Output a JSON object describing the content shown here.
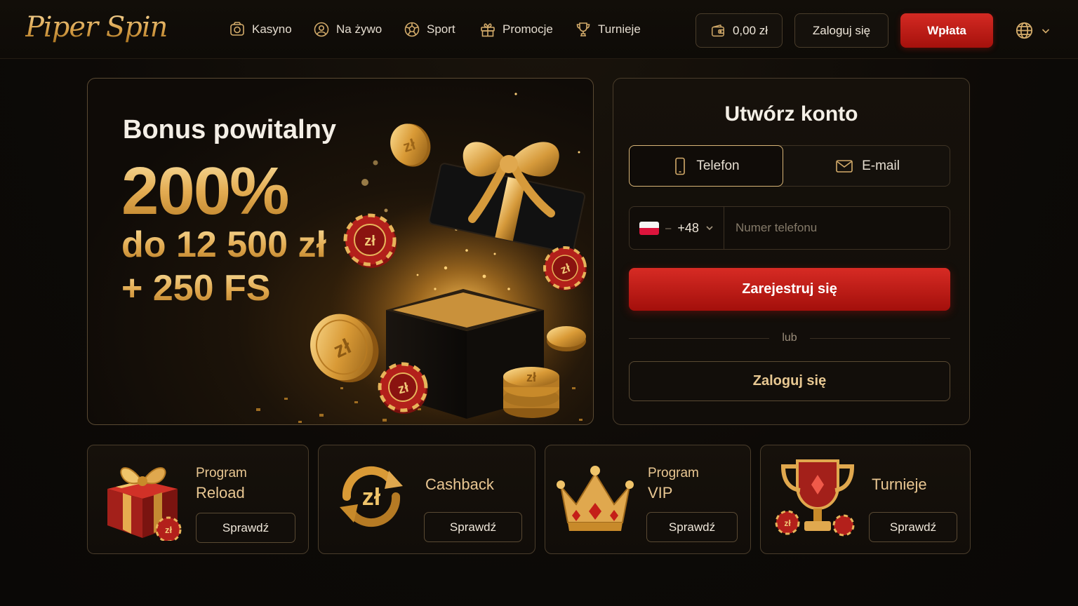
{
  "header": {
    "logo": "Piper Spin",
    "nav": [
      {
        "label": "Kasyno",
        "icon": "casino-icon"
      },
      {
        "label": "Na żywo",
        "icon": "live-icon"
      },
      {
        "label": "Sport",
        "icon": "soccer-ball-icon"
      },
      {
        "label": "Promocje",
        "icon": "gift-icon"
      },
      {
        "label": "Turnieje",
        "icon": "trophy-icon"
      }
    ],
    "balance": "0,00 zł",
    "login": "Zaloguj się",
    "deposit": "Wpłata",
    "language_icon": "globe-icon"
  },
  "hero": {
    "title": "Bonus powitalny",
    "percent": "200%",
    "amount": "do 12 500 zł",
    "free_spins": "+ 250 FS",
    "chip_symbol": "zł"
  },
  "register": {
    "title": "Utwórz konto",
    "tabs": [
      {
        "label": "Telefon",
        "icon": "smartphone-icon",
        "active": true
      },
      {
        "label": "E-mail",
        "icon": "mail-icon",
        "active": false
      }
    ],
    "country_separator": "–",
    "country_code": "+48",
    "phone_placeholder": "Numer telefonu",
    "submit": "Zarejestruj się",
    "or": "lub",
    "login": "Zaloguj się"
  },
  "promos": [
    {
      "line1": "Program",
      "line2": "Reload",
      "button": "Sprawdź",
      "icon": "gift-box-icon"
    },
    {
      "line1": "Cashback",
      "line2": "",
      "button": "Sprawdź",
      "icon": "cashback-icon"
    },
    {
      "line1": "Program",
      "line2": "VIP",
      "button": "Sprawdź",
      "icon": "crown-icon"
    },
    {
      "line1": "Turnieje",
      "line2": "",
      "button": "Sprawdź",
      "icon": "trophy-cup-icon"
    }
  ],
  "colors": {
    "gold": "#e0a84e",
    "red": "#c41e18",
    "background": "#0d0a07",
    "border": "#4a3d2b"
  }
}
